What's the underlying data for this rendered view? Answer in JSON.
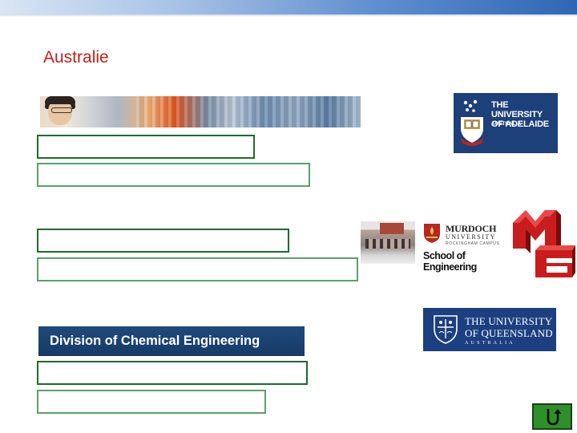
{
  "slide": {
    "title": "Australie"
  },
  "logos": {
    "adelaide": {
      "line1": "THE UNIVERSITY",
      "line2": "OF ADELAIDE",
      "line3": "AUSTRALIA"
    },
    "murdoch": {
      "name": "MURDOCH",
      "university": "UNIVERSITY",
      "campus": "ROCKINGHAM CAMPUS",
      "school": "School of Engineering"
    },
    "queensland": {
      "line1": "THE UNIVERSITY",
      "line2": "OF QUEENSLAND",
      "line3": "AUSTRALIA"
    },
    "division_banner": "Division of Chemical Engineering"
  },
  "colors": {
    "title": "#c0201e",
    "link_border_dark": "#1e6b2a",
    "link_border_light": "#5aa06a",
    "uq_blue": "#1b3f80",
    "adelaide_blue": "#1d3f7a",
    "return_button": "#2f8f2a"
  },
  "icons": {
    "return": "u-turn-arrow-icon"
  }
}
